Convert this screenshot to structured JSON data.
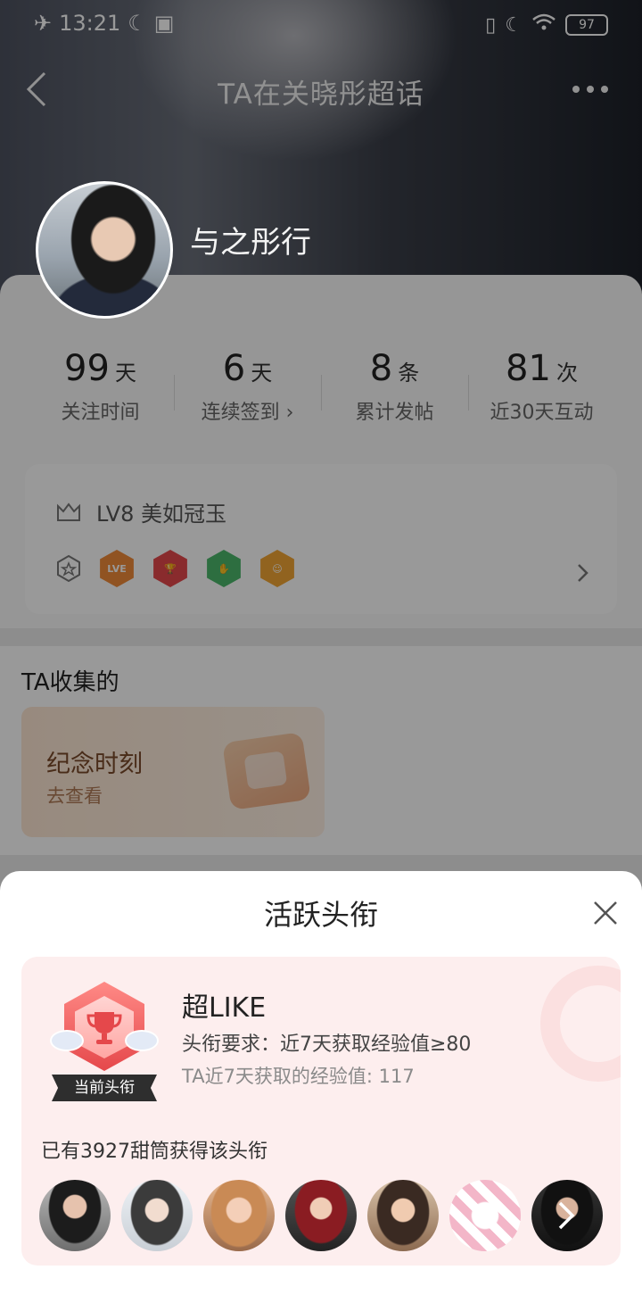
{
  "status_bar": {
    "time": "13:21",
    "battery": "97"
  },
  "navbar": {
    "title": "TA在关晓彤超话"
  },
  "profile": {
    "username": "与之彤行"
  },
  "stats": [
    {
      "value": "99",
      "unit": "天",
      "label": "关注时间"
    },
    {
      "value": "6",
      "unit": "天",
      "label": "连续签到 ›"
    },
    {
      "value": "8",
      "unit": "条",
      "label": "累计发帖"
    },
    {
      "value": "81",
      "unit": "次",
      "label": "近30天互动"
    }
  ],
  "level": {
    "text": "LV8 美如冠玉",
    "medal_first_label": "LVE"
  },
  "collection": {
    "title": "TA收集的",
    "card_title": "纪念时刻",
    "card_sub": "去查看"
  },
  "sheet": {
    "title": "活跃头衔",
    "badge_ribbon": "当前头衔",
    "title_name": "超LIKE",
    "requirement": "头衔要求：近7天获取经验值≥80",
    "exp_text": "TA近7天获取的经验值: 117",
    "holders_text": "已有3927甜筒获得该头衔"
  },
  "colors": {
    "accent": "#e5484b",
    "sheet_bg": "#fdeeee",
    "collect_card": "#fde7d3"
  }
}
